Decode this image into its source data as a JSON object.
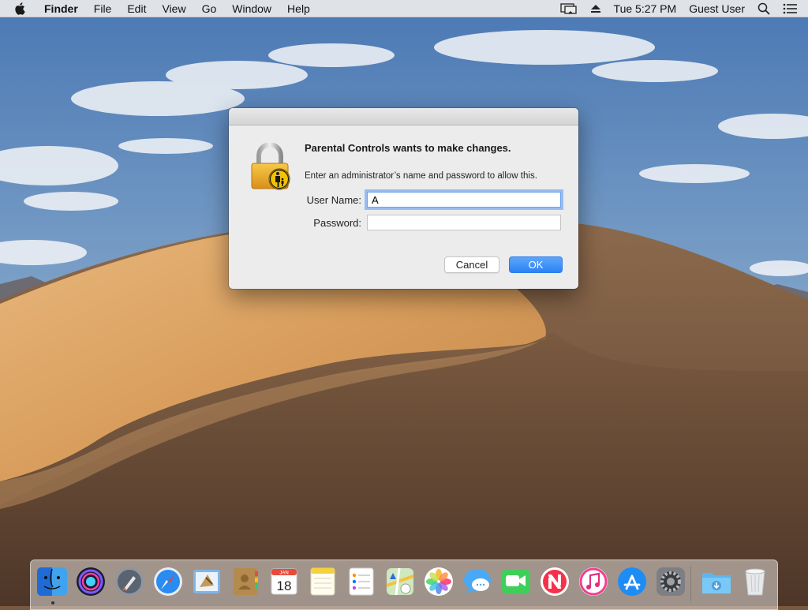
{
  "menubar": {
    "app_name": "Finder",
    "menus": [
      "File",
      "Edit",
      "View",
      "Go",
      "Window",
      "Help"
    ],
    "clock": "Tue 5:27 PM",
    "user": "Guest User",
    "icons": [
      "apple-icon",
      "airplay-display-icon",
      "eject-icon",
      "spotlight-search-icon",
      "notification-center-icon"
    ]
  },
  "dialog": {
    "heading": "Parental Controls wants to make changes.",
    "message": "Enter an administrator’s name and password to allow this.",
    "username_label": "User Name:",
    "username_value": "A",
    "password_label": "Password:",
    "password_value": "",
    "cancel_label": "Cancel",
    "ok_label": "OK",
    "icon": "parental-controls-lock-icon",
    "accent_color": "#2a82f5"
  },
  "dock": {
    "apps": [
      "Finder",
      "Siri",
      "Launchpad",
      "Safari",
      "Mail",
      "Contacts",
      "Calendar",
      "Notes",
      "Reminders",
      "Maps",
      "Photos",
      "Messages",
      "FaceTime",
      "News",
      "iTunes",
      "App Store",
      "System Preferences",
      "Downloads",
      "Trash"
    ],
    "calendar_month": "JAN",
    "calendar_day": "18"
  }
}
